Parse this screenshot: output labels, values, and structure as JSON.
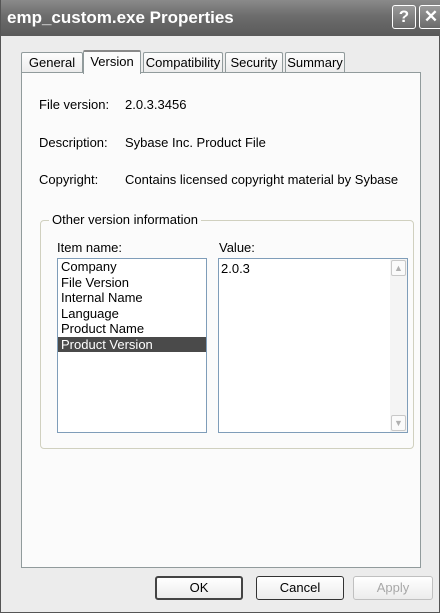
{
  "window": {
    "title": "emp_custom.exe Properties",
    "help_glyph": "?",
    "close_glyph": "✕"
  },
  "tabs": [
    {
      "label": "General"
    },
    {
      "label": "Version"
    },
    {
      "label": "Compatibility"
    },
    {
      "label": "Security"
    },
    {
      "label": "Summary"
    }
  ],
  "active_tab": "Version",
  "details": {
    "file_version_label": "File version:",
    "file_version_value": "2.0.3.3456",
    "description_label": "Description:",
    "description_value": "Sybase Inc. Product File",
    "copyright_label": "Copyright:",
    "copyright_value": "Contains licensed copyright material by Sybase"
  },
  "other_info": {
    "legend": "Other version information",
    "item_name_label": "Item name:",
    "value_label": "Value:",
    "items": [
      "Company",
      "File Version",
      "Internal Name",
      "Language",
      "Product Name",
      "Product Version"
    ],
    "selected_item": "Product Version",
    "value_text": "2.0.3"
  },
  "buttons": {
    "ok": "OK",
    "cancel": "Cancel",
    "apply": "Apply"
  },
  "icons": {
    "scroll_up": "▲",
    "scroll_down": "▼"
  }
}
